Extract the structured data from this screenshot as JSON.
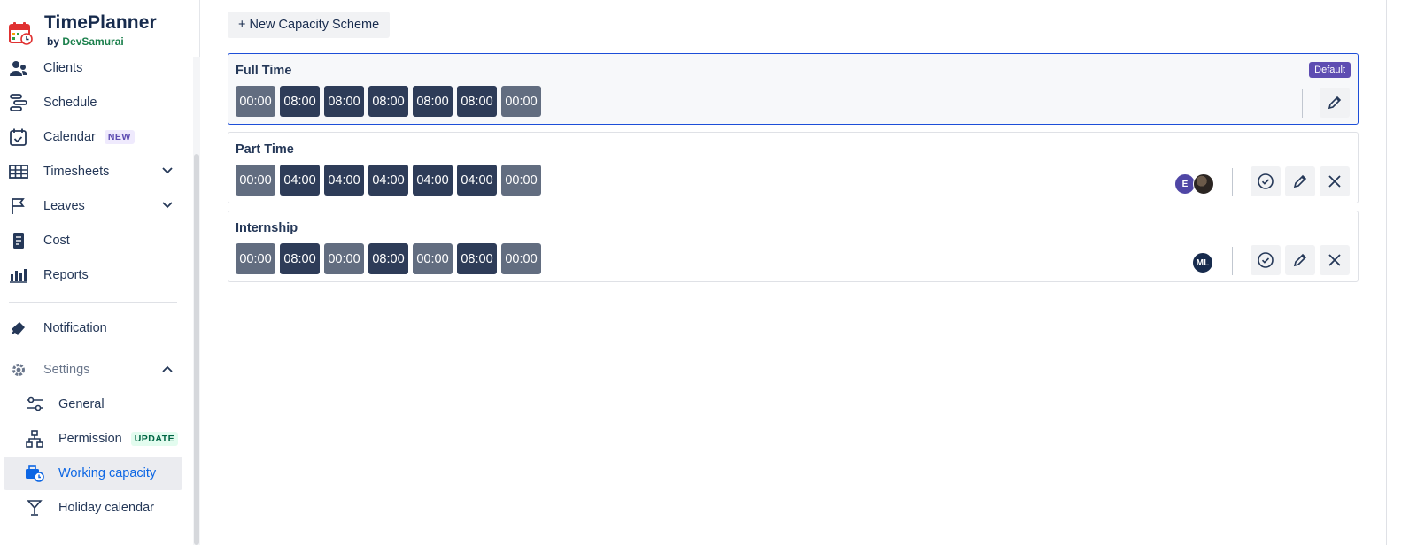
{
  "app": {
    "name": "TimePlanner",
    "by": "by",
    "brand": "DevSamurai"
  },
  "sidebar": {
    "items": [
      {
        "label": "Clients",
        "icon": "clients-icon"
      },
      {
        "label": "Schedule",
        "icon": "schedule-icon"
      },
      {
        "label": "Calendar",
        "icon": "calendar-icon",
        "badge": "NEW"
      },
      {
        "label": "Timesheets",
        "icon": "table-icon"
      },
      {
        "label": "Leaves",
        "icon": "flag-icon"
      },
      {
        "label": "Cost",
        "icon": "receipt-icon"
      },
      {
        "label": "Reports",
        "icon": "bar-chart-icon"
      },
      {
        "label": "Notification",
        "icon": "megaphone-icon"
      },
      {
        "label": "Settings",
        "icon": "gear-icon"
      }
    ],
    "settings_items": [
      {
        "label": "General",
        "icon": "sliders-icon"
      },
      {
        "label": "Permission",
        "icon": "hierarchy-icon",
        "badge": "UPDATE"
      },
      {
        "label": "Working capacity",
        "icon": "briefcase-clock-icon"
      },
      {
        "label": "Holiday calendar",
        "icon": "cocktail-icon"
      }
    ]
  },
  "toolbar": {
    "new_scheme_label": "+ New Capacity Scheme"
  },
  "schemes": [
    {
      "name": "Full Time",
      "default_badge": "Default",
      "days": [
        "00:00",
        "08:00",
        "08:00",
        "08:00",
        "08:00",
        "08:00",
        "00:00"
      ],
      "off": [
        true,
        false,
        false,
        false,
        false,
        false,
        true
      ]
    },
    {
      "name": "Part Time",
      "days": [
        "00:00",
        "04:00",
        "04:00",
        "04:00",
        "04:00",
        "04:00",
        "00:00"
      ],
      "off": [
        true,
        false,
        false,
        false,
        false,
        false,
        true
      ],
      "avatars": [
        "E",
        ""
      ]
    },
    {
      "name": "Internship",
      "days": [
        "00:00",
        "08:00",
        "00:00",
        "08:00",
        "00:00",
        "08:00",
        "00:00"
      ],
      "off": [
        true,
        false,
        true,
        false,
        true,
        false,
        true
      ],
      "avatars": [
        "ML"
      ]
    }
  ]
}
